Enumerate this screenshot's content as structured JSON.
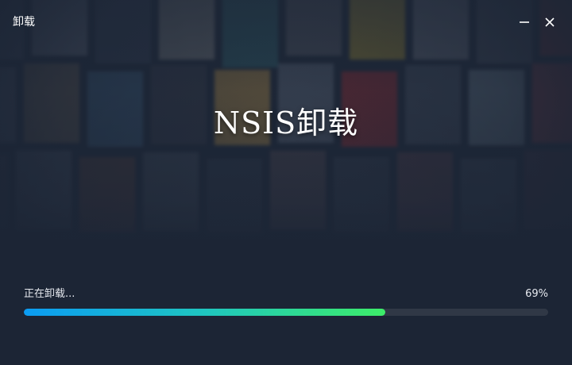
{
  "window": {
    "title": "卸载",
    "controls": {
      "minimize_icon": "minimize-icon",
      "close_icon": "close-icon"
    }
  },
  "hero": {
    "title": "NSIS卸载"
  },
  "progress": {
    "status": "正在卸载...",
    "percent_label": "69%",
    "value": 0.69
  },
  "colors": {
    "background": "#1c2535",
    "track": "#303846",
    "fill_start": "#0b9cf3",
    "fill_end": "#3ded69",
    "text": "#ffffff"
  }
}
